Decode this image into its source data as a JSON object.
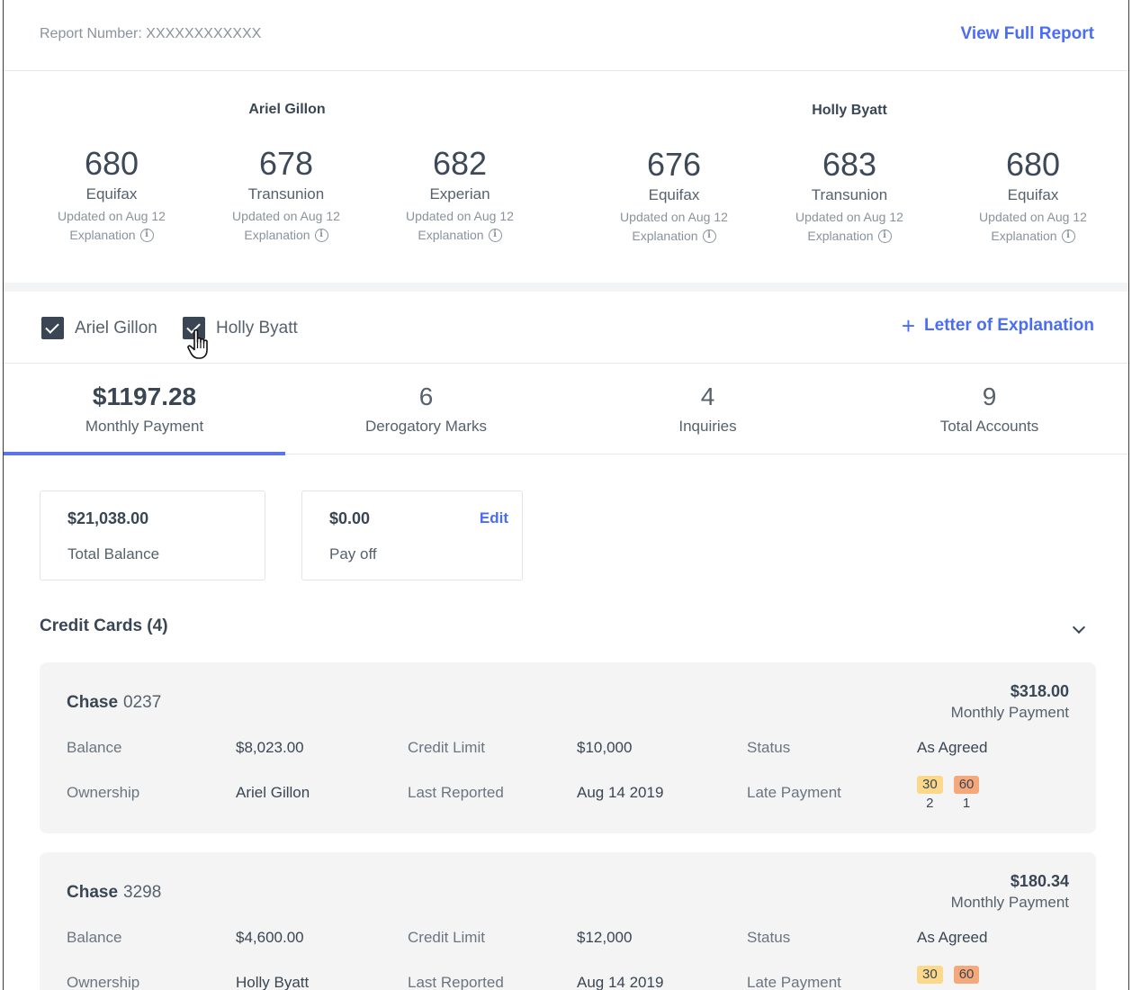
{
  "header": {
    "report_number": "Report Number: XXXXXXXXXXXX",
    "view_full_report": "View Full Report"
  },
  "people": [
    {
      "name": "Ariel Gillon",
      "scores": [
        {
          "value": "680",
          "bureau": "Equifax",
          "updated": "Updated on Aug 12",
          "explanation": "Explanation"
        },
        {
          "value": "678",
          "bureau": "Transunion",
          "updated": "Updated on Aug 12",
          "explanation": "Explanation"
        },
        {
          "value": "682",
          "bureau": "Experian",
          "updated": "Updated on Aug 12",
          "explanation": "Explanation"
        }
      ]
    },
    {
      "name": "Holly Byatt",
      "scores": [
        {
          "value": "676",
          "bureau": "Equifax",
          "updated": "Updated on Aug 12",
          "explanation": "Explanation"
        },
        {
          "value": "683",
          "bureau": "Transunion",
          "updated": "Updated on Aug 12",
          "explanation": "Explanation"
        },
        {
          "value": "680",
          "bureau": "Equifax",
          "updated": "Updated on Aug 12",
          "explanation": "Explanation"
        }
      ]
    }
  ],
  "filters": {
    "items": [
      {
        "label": "Ariel Gillon",
        "checked": true
      },
      {
        "label": "Holly Byatt",
        "checked": true
      }
    ],
    "letter_of_explanation": "Letter of Explanation"
  },
  "stats": [
    {
      "value": "$1197.28",
      "label": "Monthly Payment",
      "active": true
    },
    {
      "value": "6",
      "label": "Derogatory Marks"
    },
    {
      "value": "4",
      "label": "Inquiries"
    },
    {
      "value": "9",
      "label": "Total Accounts"
    }
  ],
  "summary": {
    "total_balance": "$21,038.00",
    "total_balance_label": "Total Balance",
    "payoff": "$0.00",
    "payoff_label": "Pay off",
    "edit": "Edit"
  },
  "section": {
    "title": "Credit Cards (4)"
  },
  "labels": {
    "balance": "Balance",
    "credit_limit": "Credit Limit",
    "status": "Status",
    "ownership": "Ownership",
    "last_reported": "Last Reported",
    "late_payment": "Late Payment",
    "monthly_payment": "Monthly Payment"
  },
  "accounts": [
    {
      "bank": "Chase",
      "number": "0237",
      "monthly": "$318.00",
      "balance": "$8,023.00",
      "limit": "$10,000",
      "status": "As Agreed",
      "owner": "Ariel Gillon",
      "reported": "Aug 14 2019",
      "late": [
        {
          "days": "30",
          "count": "2"
        },
        {
          "days": "60",
          "count": "1"
        }
      ]
    },
    {
      "bank": "Chase",
      "number": "3298",
      "monthly": "$180.34",
      "balance": "$4,600.00",
      "limit": "$12,000",
      "status": "As Agreed",
      "owner": "Holly Byatt",
      "reported": "Aug 14 2019",
      "late": [
        {
          "days": "30",
          "count": ""
        },
        {
          "days": "60",
          "count": ""
        }
      ]
    }
  ]
}
